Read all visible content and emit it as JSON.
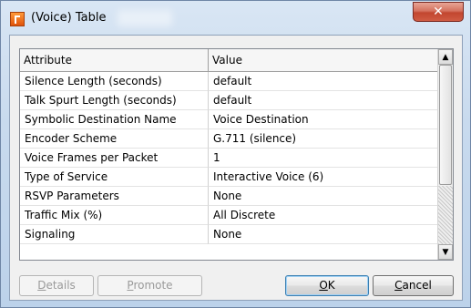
{
  "window": {
    "title": "(Voice) Table",
    "close_glyph": "✕"
  },
  "table": {
    "headers": {
      "attribute": "Attribute",
      "value": "Value"
    },
    "rows": [
      {
        "attribute": "Silence Length (seconds)",
        "value": "default"
      },
      {
        "attribute": "Talk Spurt Length (seconds)",
        "value": "default"
      },
      {
        "attribute": "Symbolic Destination Name",
        "value": "Voice Destination"
      },
      {
        "attribute": "Encoder Scheme",
        "value": "G.711 (silence)"
      },
      {
        "attribute": "Voice Frames per Packet",
        "value": "1"
      },
      {
        "attribute": "Type of Service",
        "value": "Interactive Voice (6)"
      },
      {
        "attribute": "RSVP Parameters",
        "value": "None"
      },
      {
        "attribute": "Traffic Mix (%)",
        "value": "All Discrete"
      },
      {
        "attribute": "Signaling",
        "value": "None"
      }
    ]
  },
  "buttons": {
    "details": {
      "mnemonic": "D",
      "rest": "etails"
    },
    "promote": {
      "mnemonic": "P",
      "rest": "romote"
    },
    "ok": {
      "mnemonic": "O",
      "rest": "K"
    },
    "cancel": {
      "mnemonic": "C",
      "rest": "ancel"
    }
  }
}
